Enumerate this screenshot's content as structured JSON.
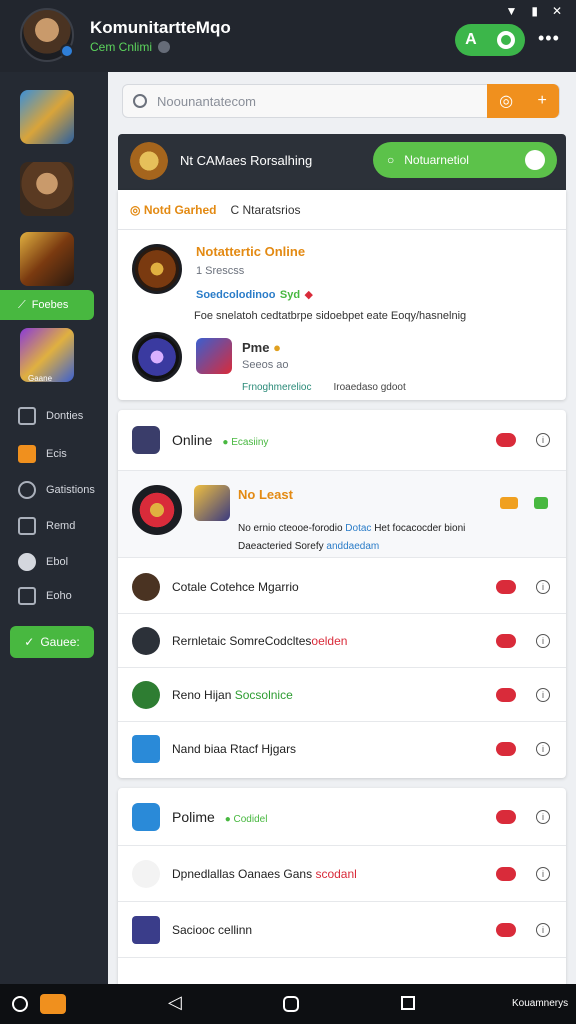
{
  "header": {
    "title": "KomunitartteMqo",
    "subtitle": "Cem Cnlimi",
    "action_letter": "A",
    "more": "•••"
  },
  "sidebar": {
    "highlight_label": "Foebes",
    "games": [
      "game-1",
      "game-2",
      "game-3",
      "game-4"
    ],
    "game4_caption": "Gaane",
    "items": [
      {
        "label": "Donties",
        "icon": "chart-icon"
      },
      {
        "label": "Ecis",
        "icon": "square-icon"
      },
      {
        "label": "Gatistions",
        "icon": "person-icon"
      },
      {
        "label": "Remd",
        "icon": "grid-icon"
      },
      {
        "label": "Ebol",
        "icon": "heart-icon"
      },
      {
        "label": "Eoho",
        "icon": "image-icon"
      }
    ],
    "button_label": "Gauee:"
  },
  "search": {
    "placeholder": "Noounantatecom"
  },
  "promo": {
    "title": "Nt CAMaes Rorsalhing",
    "toggle_label": "Notuarnetiol"
  },
  "card1": {
    "tabs": [
      "Notd Garhed",
      "Ntaratsrios"
    ],
    "game1": {
      "title": "Notattertic Online",
      "meta": "1 Srescss",
      "link": "Soedcolodinoo",
      "link2": "Syd",
      "desc": "Foe snelatoh cedtatbrpe sidoebpet eate Eoqy/hasnelnig"
    },
    "game2": {
      "title": "Pme",
      "meta": "Seeos ao",
      "desc": "Frnoghmerelioc",
      "desc2": "Iroaedaso gdoot"
    }
  },
  "card2": {
    "header_title": "Online",
    "header_badge": "Ecasiiny",
    "feature": {
      "title": "No Least",
      "desc": "No ernio cteooe-forodio",
      "desc_blue": "Dotac",
      "desc2": "Het focacocder bioni",
      "line2_a": "Daeacteried Sorefy",
      "line2_b": "anddaedam"
    },
    "rows": [
      {
        "label": "Cotale Cotehce Mgarrio",
        "accent": ""
      },
      {
        "label": "Rernletaic SomreCodcltes",
        "accent": "oelden"
      },
      {
        "label": "Reno Hijan",
        "accent": "Socsolnice"
      },
      {
        "label": "Nand biaa Rtacf Hjgars",
        "accent": ""
      }
    ]
  },
  "card3": {
    "header_title": "Polime",
    "header_badge": "Codidel",
    "rows": [
      {
        "label": "Dpnedlallas Oanaes Gans",
        "accent": "scodanl"
      },
      {
        "label": "Saciooc cellinn",
        "accent": ""
      }
    ]
  },
  "navbar": {
    "right_text": "Kouamnerys"
  },
  "colors": {
    "accent_green": "#48b840",
    "accent_orange": "#f0901e",
    "link_blue": "#2a7cc8",
    "danger_red": "#d92b3a"
  }
}
